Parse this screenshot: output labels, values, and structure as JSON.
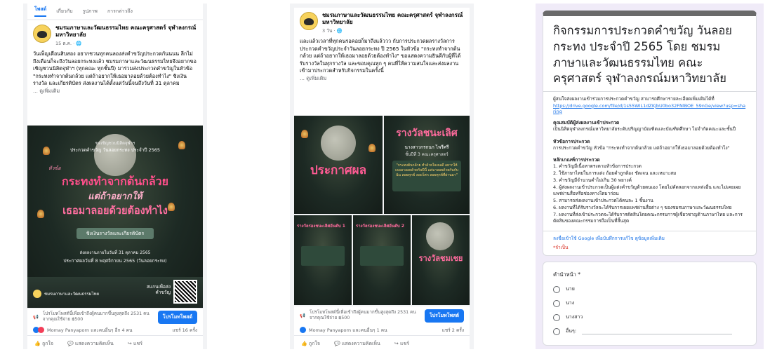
{
  "panel1": {
    "tabs": [
      "โพสต์",
      "เกี่ยวกับ",
      "รูปภาพ",
      "การกล่าวถึง"
    ],
    "page_name": "ชมรมภาษาและวัฒนธรรมไทย คณะครุศาสตร์ จุฬาลงกรณ์มหาวิทยาลัย",
    "time": "15 ต.ค. · 🌐",
    "body": "วันเพ็ญเดือนสิบสอง อยากชวนทุกคนลองส่งคำขวัญประกวดกันนนน ลีกไม่ถึงเดือนก็จะถึงวันลอยกระทงแล้ว ชมรมภาษาและวัฒนธรรมไทยจึงอยากขอเชิญชวนนิสิตจุฬาฯ (ทุกคณะ ทุกชั้นปี) มาร่วมส่งประกวดคำขวัญในหัวข้อ \"กระทงทำจากต้นกล้วย แต่ถ้าอยากให้เธอมาลอยด้วยต้องทำไง\" ชิงเงินรางวัล และเกียรติบัตร ส่งผลงานได้ตั้งแต่วันนี้จนถึงวันที่ 31 ตุลาคม",
    "see_more": "... ดูเพิ่มเติม",
    "poster": {
      "invite_line1": "ขอเชิญชวนนิสิตจุฬาฯ",
      "invite_line2": "ประกวดคำขวัญ วันลอยกระทง ประจำปี 2565",
      "topic_label": "หัวข้อ",
      "headline1": "กระทงทำจากต้นกล้วย",
      "headline2": "แต่ถ้าอยากให้",
      "headline3": "เธอมาลอยด้วยต้องทำไง",
      "prize": "ชิงเงินรางวัลและเกียรติบัตร",
      "deadline": "ส่งผลงานภายในวันที่ 31 ตุลาคม 2565",
      "announce": "ประกาศผลวันที่ 8 พฤศจิกายน 2565 (วันลอยกระทง)",
      "club": "ชมรมภาษาและวัฒนธรรมไทย",
      "scan": "สแกนเพื่อส่งคำขวัญ"
    },
    "promo_text": "โปรโมทโพสต์นี้เพื่อเข้าถึงผู้คนมากขึ้นสูงสุดถึง 2531 คนจากคุณใช้จ่าย ฿500",
    "promo_button": "โปรโมทโพสต์",
    "reacts_text": "Momay Panyaporn และคนอื่นๆ อีก 4 คน",
    "shares": "แชร์ 16 ครั้ง",
    "actions": [
      "ถูกใจ",
      "แสดงความคิดเห็น",
      "แชร์"
    ]
  },
  "panel2": {
    "page_name": "ชมรมภาษาและวัฒนธรรมไทย คณะครุศาสตร์ จุฬาลงกรณ์มหาวิทยาลัย",
    "time": "3 วัน · 🌐",
    "body": "และแล้วเวลาที่ทุกคนรอคอยก็มาถึงแล้ววว กับการประกวดผลรางวัลการประกวดคำขวัญประจำวันลอยกระทง ปี 2565 ในหัวข้อ \"กระทงทำจากต้นกล้วย แต่ถ้าอยากให้เธอมาลอยด้วยต้องทำไง\" ขอแสดงความยินดีกับผู้ที่ได้รับรางวัลในทุกรางวัล และขอบคุณทุก ๆ คนที่ให้ความสนใจและส่งผลงานเข้ามาประกวดสำหรับกิจกรรมในครั้งนี้",
    "see_more": "... ดูเพิ่มเติม",
    "tile_announce": "ประกาศผล",
    "tile_winner": "รางวัลชนะเลิศ",
    "tile_winner_name": "นางสาวกรกนก ไพรีศรี",
    "tile_winner_year": "ชั้นปีที่ 3 คณะครุศาสตร์",
    "tile_winner_quote": "\"กระทงต้นกล้วย ทำด้วยใจเธอดี อยากให้เธอมาลอยด้วยกันปีนี้ แค่มาลอยด้วยกันกับฉัน ลอยทุกข์ ลอยโศก ลอยทุกข์ที่ผ่านมา\"",
    "tile_second1": "รางวัลรองชนะเลิศอันดับ 1",
    "tile_second2": "รางวัลรองชนะเลิศอันดับ 2",
    "tile_honor": "รางวัลชมเชย",
    "promo_text": "โปรโมทโพสต์นี้เพื่อเข้าถึงผู้คนมากขึ้นสูงสุดถึง 2531 คนจากคุณใช้จ่าย ฿500",
    "promo_button": "โปรโมทโพสต์",
    "reacts_text": "Momay Panyaporn และคนอื่นๆ 1 คน",
    "shares": "แชร์ 2 ครั้ง",
    "actions": [
      "ถูกใจ",
      "แสดงความคิดเห็น",
      "แชร์"
    ]
  },
  "panel3": {
    "title": "กิจกรรมการประกวดคำขวัญ วันลอยกระทง ประจำปี 2565 โดย ชมรมภาษาและวัฒนธรรมไทย คณะครุศาสตร์ จุฬาลงกรณ์มหาวิทยาลัย",
    "intro": "ผู้สนใจส่งผลงานเข้าร่วมการประกวดคำขวัญ สามารถศึกษารายละเอียดเพิ่มเติมได้ที่",
    "link": "https://drive.google.com/file/d/1s55WIL1dZKjbU0bo32FNlBOE_59nGe/view?usp=sharing",
    "qual_head": "คุณสมบัติผู้ส่งผลงานเข้าประกวด",
    "qual_text": "เป็นนิสิตจุฬาลงกรณ์มหาวิทยาลัยระดับปริญญาบัณฑิตและบัณฑิตศึกษา ไม่จำกัดคณะและชั้นปี",
    "topic_head": "หัวข้อการประกวด",
    "topic_text": "การประกวดคำขวัญ หัวข้อ \"กระทงทำจากต้นกล้วย แต่ถ้าอยากให้เธอมาลอยด้วยต้องทำไง\"",
    "rules_head": "หลักเกณฑ์การประกวด",
    "rules": [
      "1. คำขวัญมีเนื้อหาตรงตามหัวข้อการประกวด",
      "2. ใช้ภาษาไทยในการแต่ง ถ้อยคำถูกต้อง ชัดเจน และเหมาะสม",
      "3. คำขวัญมีจำนวนคำไม่เกิน 30 พยางค์",
      "4. ผู้ส่งผลงานเข้าประกวดเป็นผู้แต่งคำขวัญด้วยตนเอง โดยไม่คัดลอกจากแหล่งอื่น และไม่เคยเผยแพร่ผ่านสื่อหรือช่องทางใดมาก่อน",
      "5. สามารถส่งผลงานเข้าประกวดได้คนละ 1 ชิ้นงาน",
      "6. ผลงานที่ได้รับรางวัลจะได้รับการเผยแพร่ผ่านสื่อต่าง ๆ ของชมรมภาษาและวัฒนธรรมไทย",
      "7. ผลงานที่ส่งเข้าประกวดจะได้รับการตัดสินโดยคณะกรรมการผู้เชี่ยวชาญด้านภาษาไทย และการตัดสินของคณะกรรมการถือเป็นที่สิ้นสุด"
    ],
    "signin": "ลงชื่อเข้าใช้ Google เพื่อบันทึกการแก้ไข ดูข้อมูลเพิ่มเติม",
    "required": "*จำเป็น",
    "q_label": "คำนำหน้า *",
    "options": [
      "นาย",
      "นาง",
      "นางสาว",
      "อื่นๆ:"
    ]
  }
}
